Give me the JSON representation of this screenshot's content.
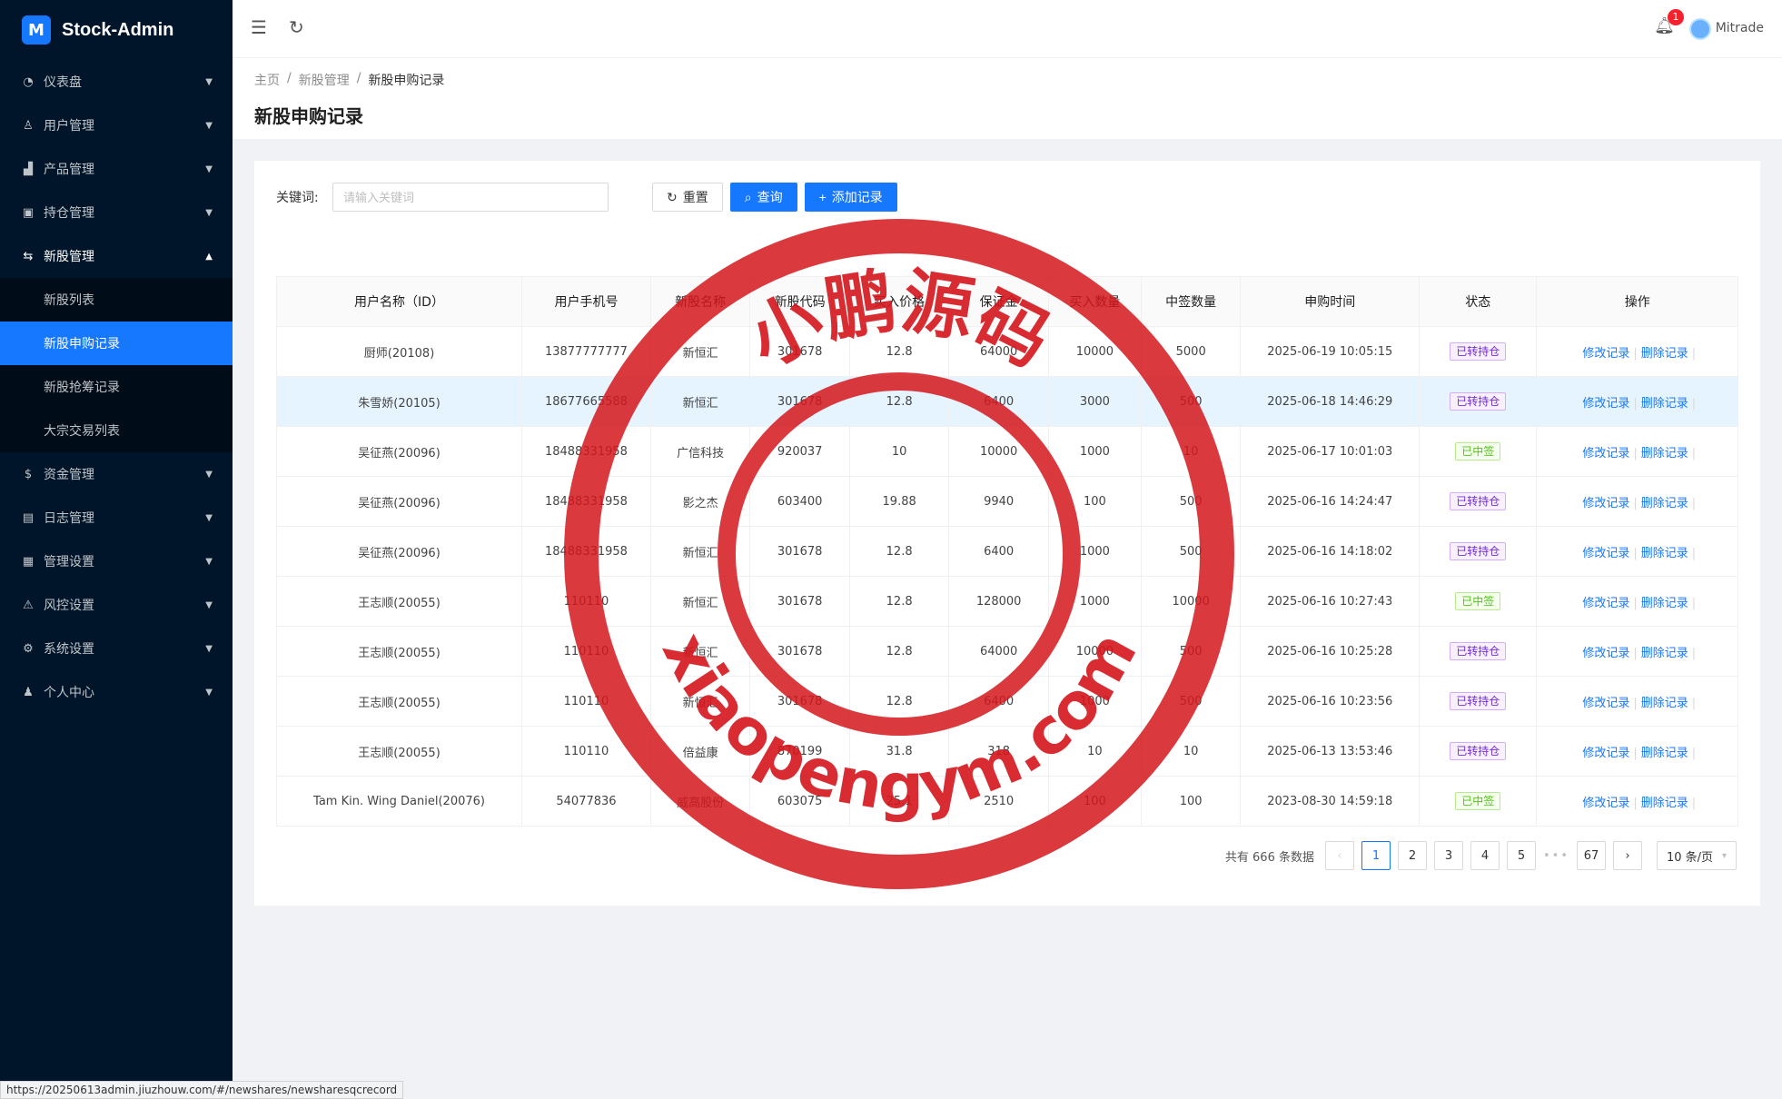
{
  "app": {
    "logo_mark": "M",
    "title": "Stock-Admin"
  },
  "sidebar": {
    "items": [
      {
        "label": "仪表盘",
        "icon": "dashboard-icon",
        "glyph": "◔"
      },
      {
        "label": "用户管理",
        "icon": "users-icon",
        "glyph": "♙"
      },
      {
        "label": "产品管理",
        "icon": "chart-icon",
        "glyph": "▟"
      },
      {
        "label": "持仓管理",
        "icon": "holding-icon",
        "glyph": "▣"
      },
      {
        "label": "新股管理",
        "icon": "ipo-icon",
        "glyph": "⇆",
        "open": true,
        "children": [
          {
            "label": "新股列表"
          },
          {
            "label": "新股申购记录",
            "active": true
          },
          {
            "label": "新股抢筹记录"
          },
          {
            "label": "大宗交易列表"
          }
        ]
      },
      {
        "label": "资金管理",
        "icon": "money-icon",
        "glyph": "$"
      },
      {
        "label": "日志管理",
        "icon": "log-icon",
        "glyph": "▤"
      },
      {
        "label": "管理设置",
        "icon": "admin-settings-icon",
        "glyph": "▦"
      },
      {
        "label": "风控设置",
        "icon": "warning-icon",
        "glyph": "⚠"
      },
      {
        "label": "系统设置",
        "icon": "gear-icon",
        "glyph": "⚙"
      },
      {
        "label": "个人中心",
        "icon": "user-icon",
        "glyph": "♟"
      }
    ]
  },
  "header": {
    "notifications": "1",
    "username": "Mitrade"
  },
  "breadcrumb": [
    "主页",
    "新股管理",
    "新股申购记录"
  ],
  "page_title": "新股申购记录",
  "search": {
    "label": "关键词:",
    "placeholder": "请输入关键词",
    "reset_label": "重置",
    "query_label": "查询",
    "add_label": "添加记录"
  },
  "table": {
    "columns": [
      "用户名称（ID）",
      "用户手机号",
      "新股名称",
      "新股代码",
      "买入价格",
      "保证金",
      "买入数量",
      "中签数量",
      "申购时间",
      "状态",
      "操作"
    ],
    "rows": [
      [
        "厨师(20108)",
        "13877777777",
        "新恒汇",
        "301678",
        "12.8",
        "64000",
        "10000",
        "5000",
        "2025-06-19 10:05:15",
        "已转持仓"
      ],
      [
        "朱雪娇(20105)",
        "18677665588",
        "新恒汇",
        "301678",
        "12.8",
        "6400",
        "3000",
        "500",
        "2025-06-18 14:46:29",
        "已转持仓"
      ],
      [
        "吴征燕(20096)",
        "18488331958",
        "广信科技",
        "920037",
        "10",
        "10000",
        "1000",
        "10",
        "2025-06-17 10:01:03",
        "已中签"
      ],
      [
        "吴征燕(20096)",
        "18488331958",
        "影之杰",
        "603400",
        "19.88",
        "9940",
        "100",
        "500",
        "2025-06-16 14:24:47",
        "已转持仓"
      ],
      [
        "吴征燕(20096)",
        "18488331958",
        "新恒汇",
        "301678",
        "12.8",
        "6400",
        "1000",
        "500",
        "2025-06-16 14:18:02",
        "已转持仓"
      ],
      [
        "王志顺(20055)",
        "110110",
        "新恒汇",
        "301678",
        "12.8",
        "128000",
        "1000",
        "10000",
        "2025-06-16 10:27:43",
        "已中签"
      ],
      [
        "王志顺(20055)",
        "110110",
        "新恒汇",
        "301678",
        "12.8",
        "64000",
        "10000",
        "500",
        "2025-06-16 10:25:28",
        "已转持仓"
      ],
      [
        "王志顺(20055)",
        "110110",
        "新恒汇",
        "301678",
        "12.8",
        "6400",
        "1000",
        "500",
        "2025-06-16 10:23:56",
        "已转持仓"
      ],
      [
        "王志顺(20055)",
        "110110",
        "倍益康",
        "870199",
        "31.8",
        "318",
        "10",
        "10",
        "2025-06-13 13:53:46",
        "已转持仓"
      ],
      [
        "Tam Kin. Wing Daniel(20076)",
        "54077836",
        "威高股份",
        "603075",
        "25.1",
        "2510",
        "100",
        "100",
        "2023-08-30 14:59:18",
        "已中签"
      ]
    ],
    "edit_label": "修改记录",
    "delete_label": "删除记录"
  },
  "pagination": {
    "total_text": "共有 666 条数据",
    "pages": [
      "1",
      "2",
      "3",
      "4",
      "5"
    ],
    "current": "1",
    "ellipsis": "•••",
    "last": "67",
    "page_size": "10 条/页"
  },
  "status_url": "https://20250613admin.jiuzhouw.com/#/newshares/newsharesqcrecord",
  "watermark": {
    "top_text": "小鹏源码",
    "bottom_text": "xiaopengym.com",
    "color": "#d4161c"
  },
  "colors": {
    "primary": "#1677ff",
    "sidebar": "#001529",
    "tag_purple": "#722ed1",
    "tag_green": "#52c41a"
  }
}
